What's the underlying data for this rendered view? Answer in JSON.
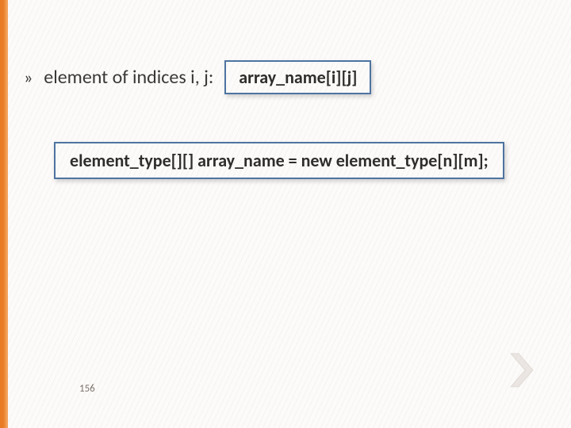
{
  "bullet_glyph": "»",
  "lead_text": "element of indices i, j:",
  "access_expr": "array_name[i][j]",
  "declaration": "element_type[][] array_name = new element_type[n][m];",
  "page_number": "156"
}
